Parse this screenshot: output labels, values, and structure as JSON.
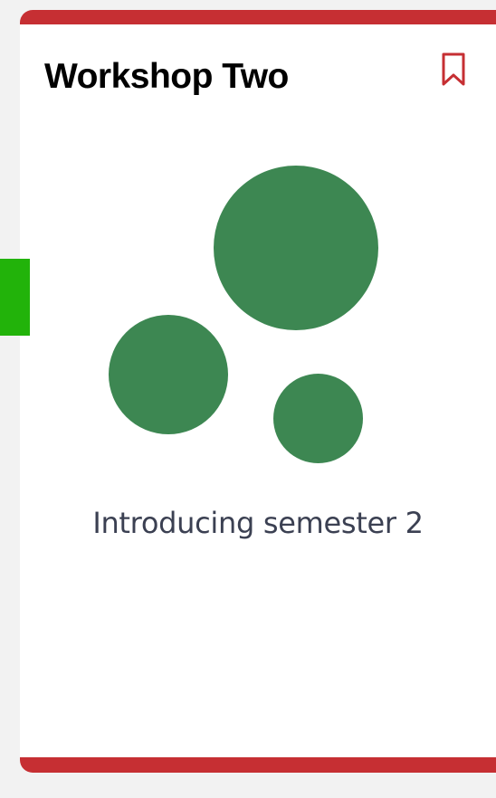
{
  "colors": {
    "accent": "#c62f33",
    "circle": "#3d8752",
    "side_tab": "#22b30a",
    "page_background": "#f2f2f2"
  },
  "card": {
    "title": "Workshop Two",
    "subtitle": "Introducing semester 2",
    "bookmark_icon": "bookmark-icon",
    "illustration_icon": "circles-illustration"
  }
}
